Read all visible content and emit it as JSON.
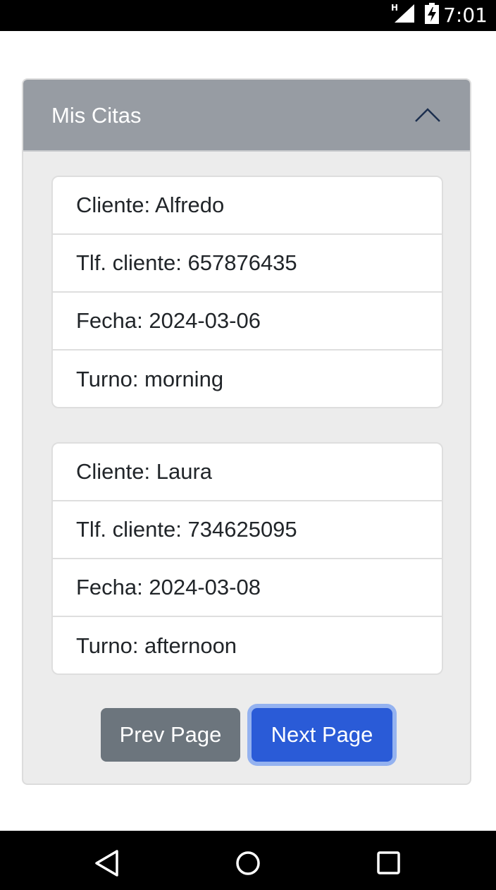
{
  "status_bar": {
    "time": "7:01",
    "network_label": "H",
    "icons": [
      "signal-icon",
      "battery-charging-icon"
    ]
  },
  "panel": {
    "title": "Mis Citas",
    "expanded": true,
    "header_color": "#979ca3",
    "toggle_icon": "chevron-up-icon"
  },
  "appointments": [
    {
      "client": "Cliente: Alfredo",
      "phone": "Tlf. cliente: 657876435",
      "date": "Fecha: 2024-03-06",
      "shift": "Turno: morning"
    },
    {
      "client": "Cliente: Laura",
      "phone": "Tlf. cliente: 734625095",
      "date": "Fecha: 2024-03-08",
      "shift": "Turno: afternoon"
    }
  ],
  "pagination": {
    "prev_label": "Prev Page",
    "next_label": "Next Page",
    "prev_color": "#6c757d",
    "next_color": "#2a5bd7"
  },
  "nav_bar": {
    "icons": [
      "back-icon",
      "home-icon",
      "recents-icon"
    ]
  }
}
